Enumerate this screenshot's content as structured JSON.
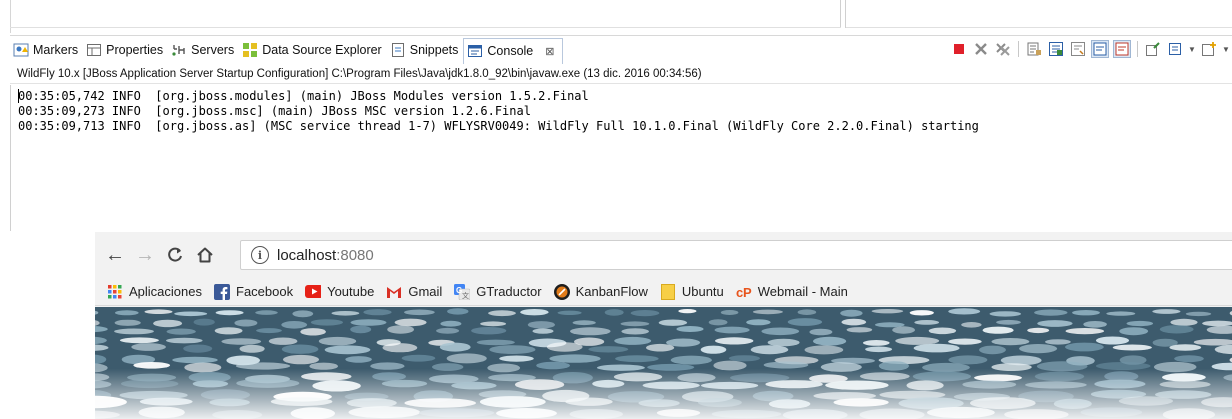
{
  "eclipse": {
    "tabs": [
      {
        "label": "Markers",
        "icon": "markers-icon"
      },
      {
        "label": "Properties",
        "icon": "properties-icon"
      },
      {
        "label": "Servers",
        "icon": "servers-icon"
      },
      {
        "label": "Data Source Explorer",
        "icon": "data-source-explorer-icon"
      },
      {
        "label": "Snippets",
        "icon": "snippets-icon"
      },
      {
        "label": "Console",
        "icon": "console-icon",
        "active": true,
        "close": "⊠"
      }
    ],
    "toolbar_icons": [
      "terminate-icon",
      "remove-launch-icon",
      "remove-all-terminated-icon",
      "clear-console-icon",
      "scroll-lock-icon",
      "word-wrap-icon",
      "show-on-stdout-icon",
      "show-on-stderr-icon",
      "pin-console-icon",
      "display-selected-console-icon",
      "open-console-icon"
    ],
    "console_title": "WildFly 10.x [JBoss Application Server Startup Configuration] C:\\Program Files\\Java\\jdk1.8.0_92\\bin\\javaw.exe (13 dic. 2016 00:34:56)",
    "log_lines": [
      "00:35:05,742 INFO  [org.jboss.modules] (main) JBoss Modules version 1.5.2.Final",
      "00:35:09,273 INFO  [org.jboss.msc] (main) JBoss MSC version 1.2.6.Final",
      "00:35:09,713 INFO  [org.jboss.as] (MSC service thread 1-7) WFLYSRV0049: WildFly Full 10.1.0.Final (WildFly Core 2.2.0.Final) starting"
    ],
    "colors": {
      "active_tab_border": "#b9c8dd",
      "terminate_red": "#e0202a"
    }
  },
  "browser": {
    "nav": {
      "back": "←",
      "forward": "→",
      "reload": "C",
      "home": "⌂"
    },
    "address": {
      "host": "localhost",
      "port": ":8080",
      "info_glyph": "i"
    },
    "bookmarks": [
      {
        "label": "Aplicaciones",
        "icon": "apps-grid-icon"
      },
      {
        "label": "Facebook",
        "icon": "facebook-icon"
      },
      {
        "label": "Youtube",
        "icon": "youtube-icon"
      },
      {
        "label": "Gmail",
        "icon": "gmail-icon"
      },
      {
        "label": "GTraductor",
        "icon": "google-translate-icon"
      },
      {
        "label": "KanbanFlow",
        "icon": "kanbanflow-icon"
      },
      {
        "label": "Ubuntu",
        "icon": "folder-icon"
      },
      {
        "label": "Webmail - Main",
        "icon": "webmail-icon"
      }
    ]
  }
}
